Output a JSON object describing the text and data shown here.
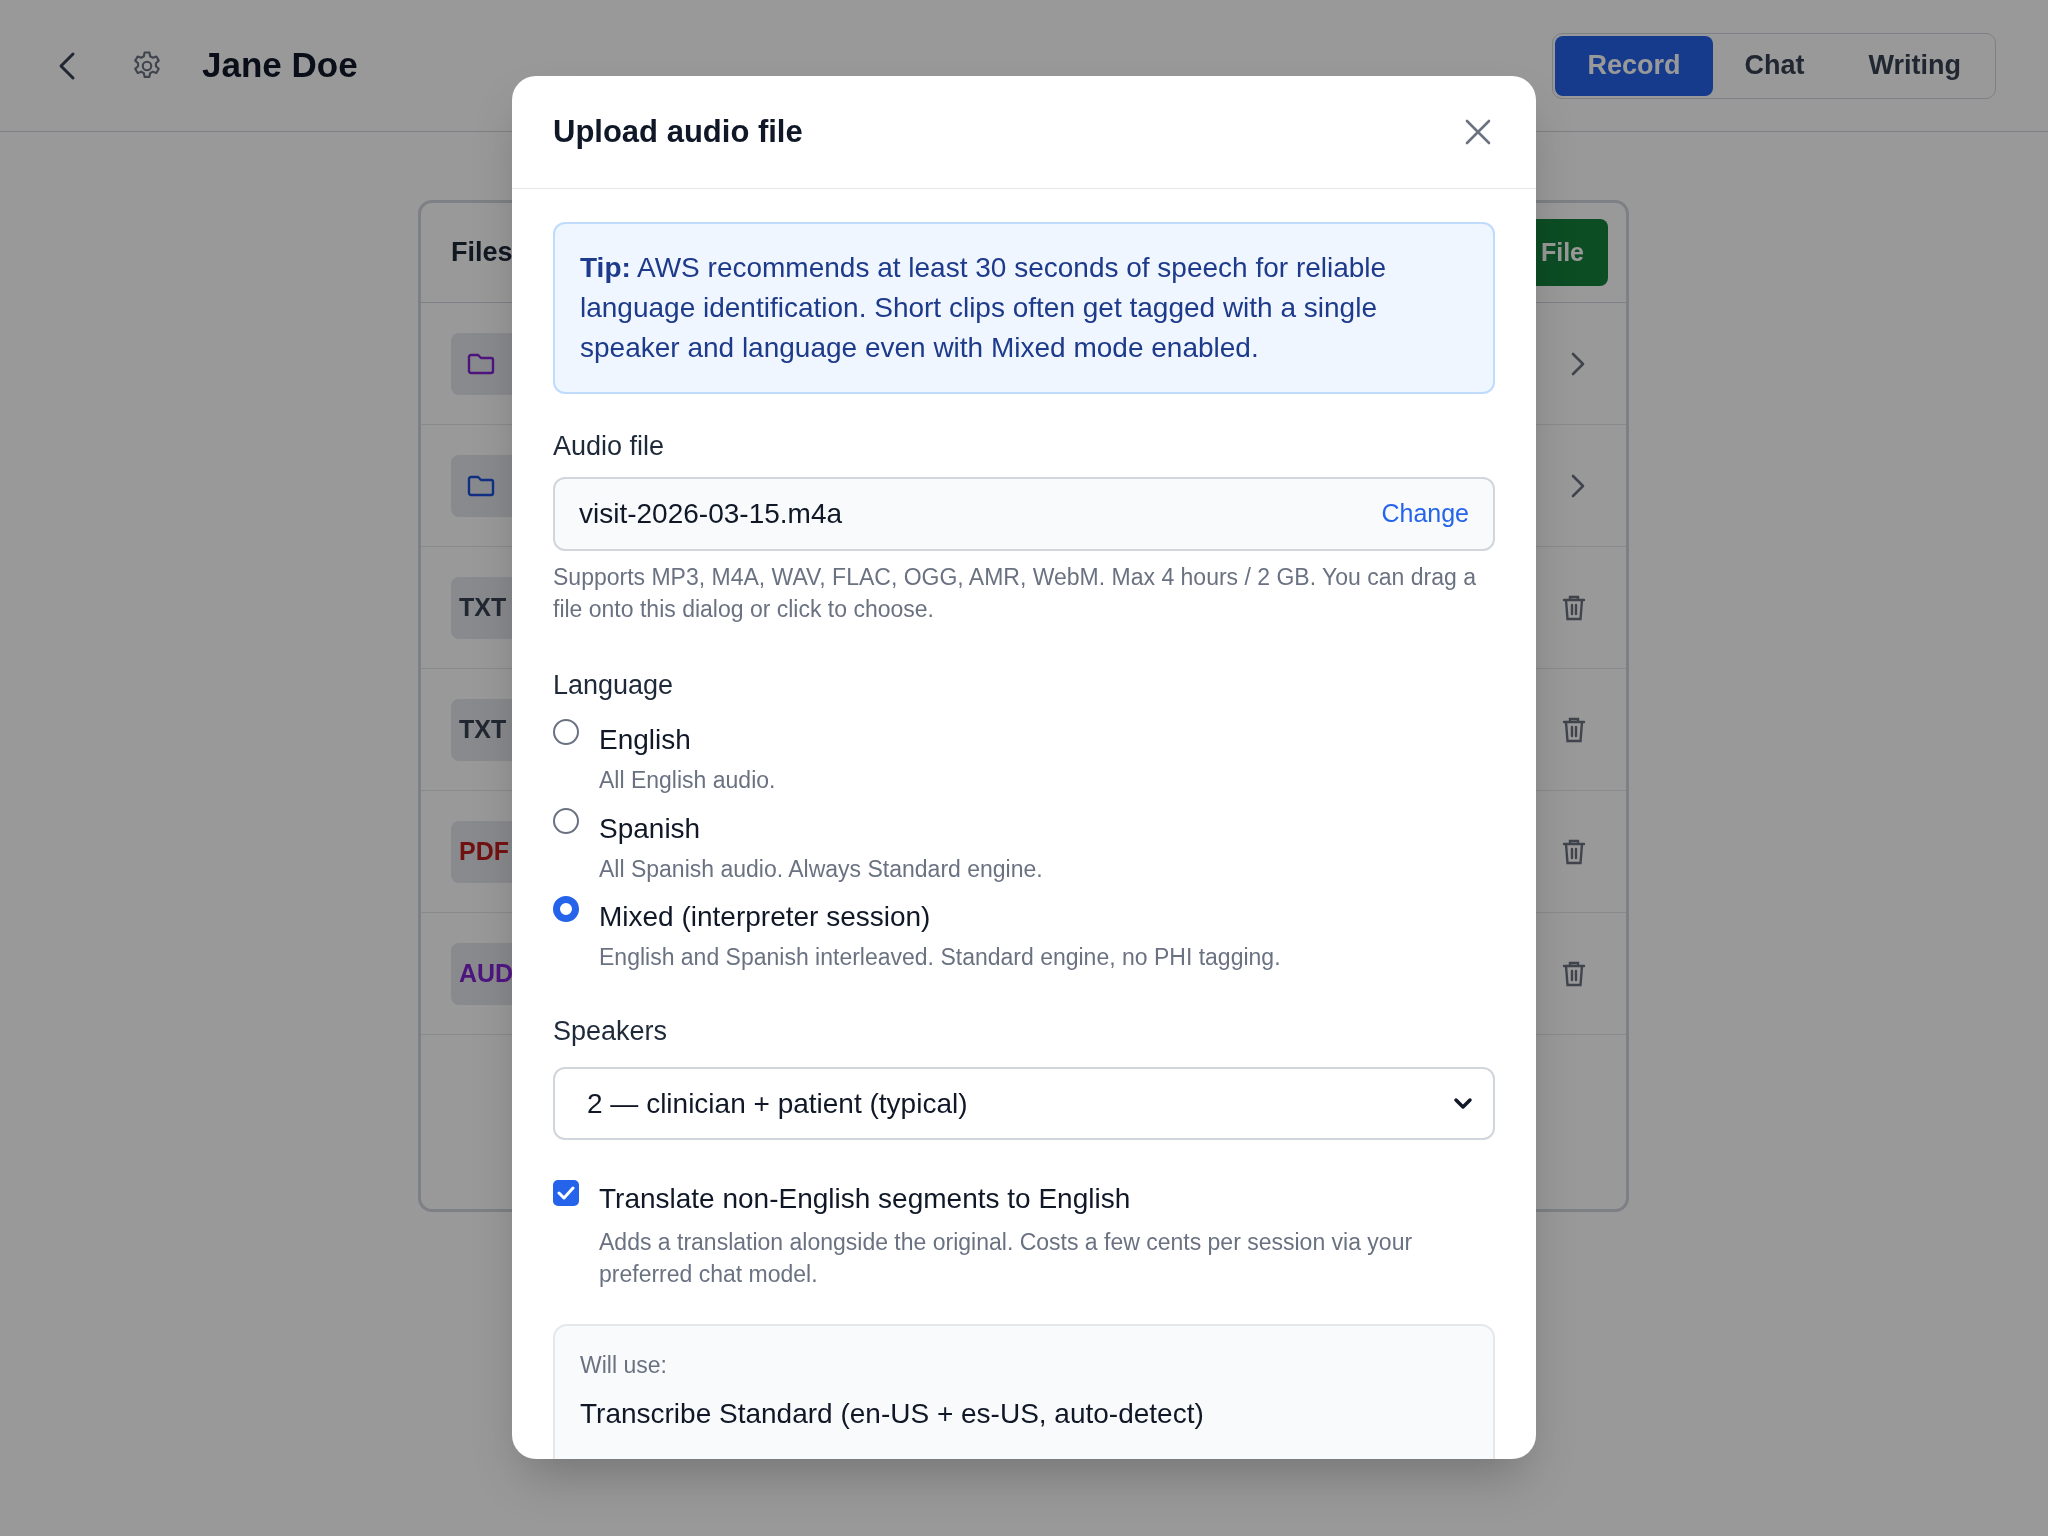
{
  "header": {
    "title": "Jane Doe"
  },
  "tabs": [
    {
      "label": "Record",
      "selected": true
    },
    {
      "label": "Chat",
      "selected": false
    },
    {
      "label": "Writing",
      "selected": false
    }
  ],
  "files_panel": {
    "title": "Files",
    "button": "File",
    "rows": [
      {
        "kind": "folder",
        "color": "#4c147c"
      },
      {
        "kind": "folder",
        "color": "#112f82"
      },
      {
        "kind": "file",
        "label": "TXT",
        "color": "#212731"
      },
      {
        "kind": "file",
        "label": "TXT",
        "color": "#212731"
      },
      {
        "kind": "file",
        "label": "PDF",
        "color": "#6f1111"
      },
      {
        "kind": "file",
        "label": "AUD",
        "color": "#4c147c"
      }
    ]
  },
  "dialog": {
    "title": "Upload audio file",
    "tip": "**Tip:** AWS recommends at least 30 seconds of speech for reliable language identification. Short clips often get tagged with a single speaker and language even with Mixed mode enabled.",
    "audio_file": {
      "label": "Audio file",
      "value": "visit-2026-03-15.m4a",
      "action": "Change",
      "help": "Supports MP3, M4A, WAV, FLAC, OGG, AMR, WebM. Max 4 hours / 2 GB. You can drag a file onto this dialog or click to choose."
    },
    "language": {
      "label": "Language",
      "options": [
        {
          "label": "English",
          "description": "All English audio.",
          "selected": false
        },
        {
          "label": "Spanish",
          "description": "All Spanish audio. Always Standard engine.",
          "selected": false
        },
        {
          "label": "Mixed (interpreter session)",
          "description": "English and Spanish interleaved. Standard engine, no PHI tagging.",
          "selected": true
        }
      ]
    },
    "speakers": {
      "label": "Speakers",
      "value": "2 — clinician + patient (typical)"
    },
    "translate": {
      "label": "Translate non-English segments to English",
      "description": "Adds a translation alongside the original. Costs a few cents per session via your preferred chat model.",
      "checked": true
    },
    "summary": {
      "label": "Will use:",
      "value": "Transcribe Standard (en-US + es-US, auto-detect)"
    }
  }
}
